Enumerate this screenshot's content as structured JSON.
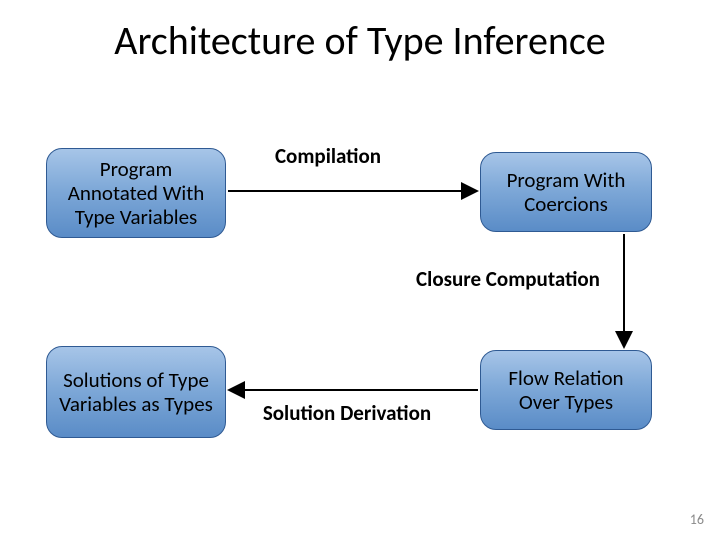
{
  "title": "Architecture of Type Inference",
  "boxes": {
    "annotated": "Program Annotated With Type Variables",
    "coercions": "Program With Coercions",
    "flow": "Flow Relation Over Types",
    "solutions": "Solutions of Type Variables as Types"
  },
  "labels": {
    "compilation": "Compilation",
    "closure": "Closure Computation",
    "derivation": "Solution Derivation"
  },
  "page_number": "16"
}
